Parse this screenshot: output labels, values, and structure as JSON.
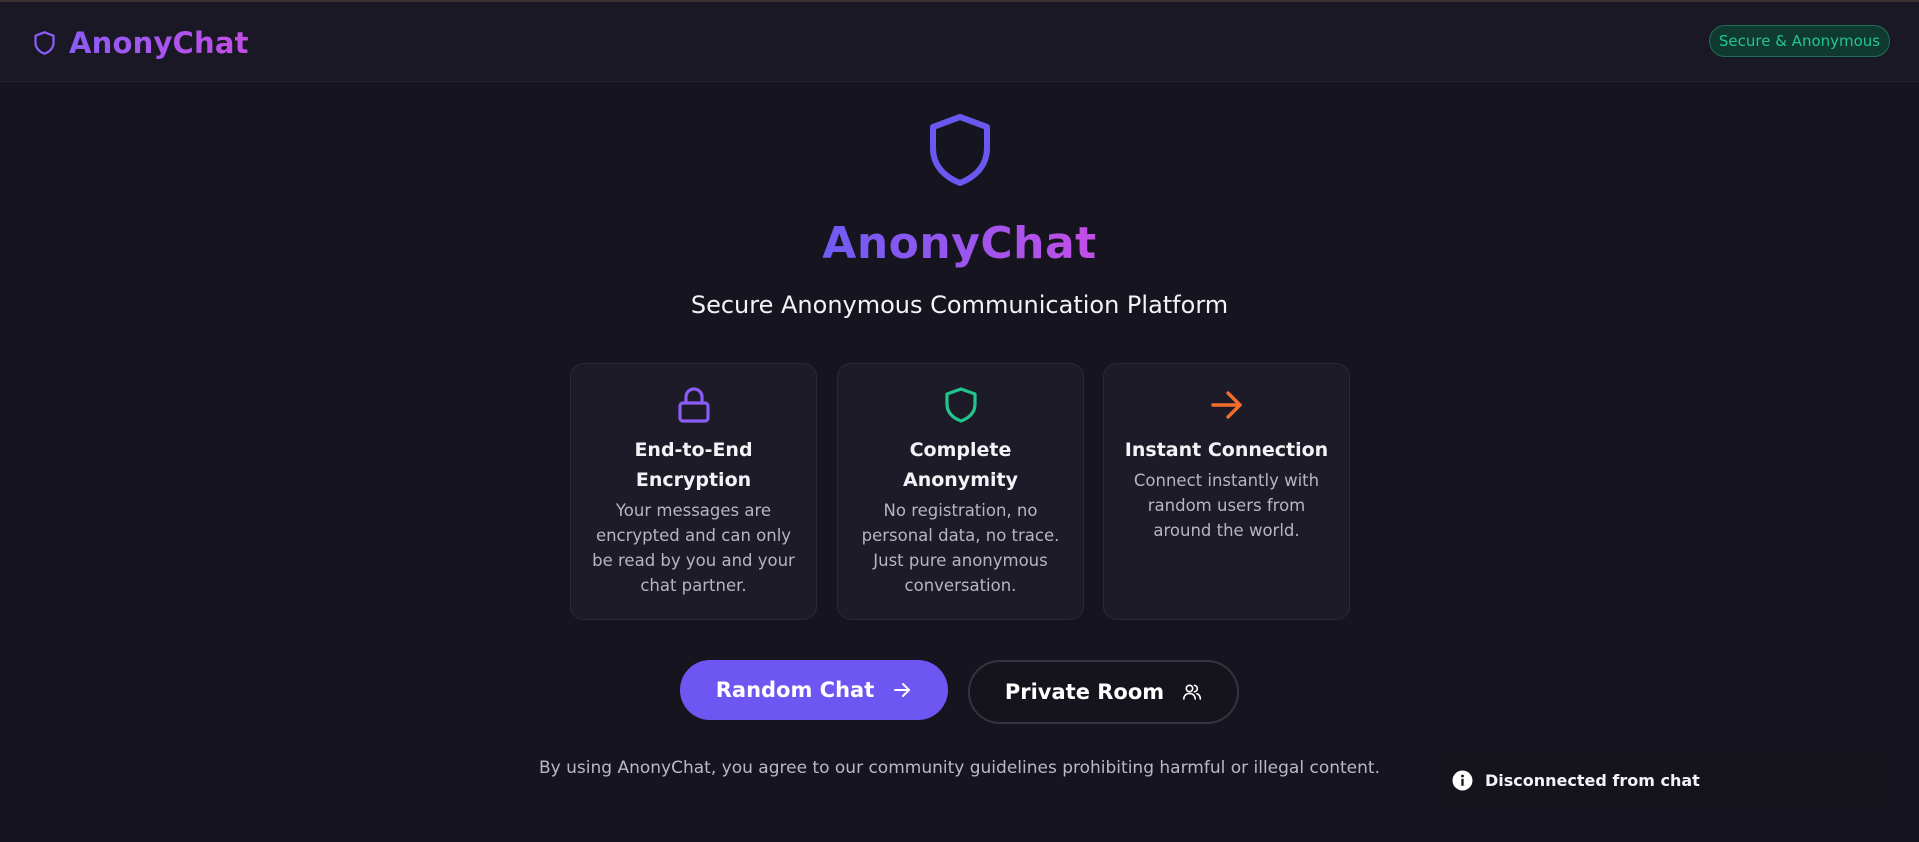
{
  "header": {
    "brand_name": "AnonyChat",
    "badge_text": "Secure & Anonymous",
    "brand_icon": "shield-icon"
  },
  "hero": {
    "title": "AnonyChat",
    "subtitle": "Secure Anonymous Communication Platform",
    "icon": "shield-icon"
  },
  "features": [
    {
      "icon": "lock-icon",
      "color": "#8b5cf6",
      "title_lines": [
        "End-to-End",
        "Encryption"
      ],
      "desc_lines": [
        "Your messages are",
        "encrypted and can only",
        "be read by you and your",
        "chat partner."
      ]
    },
    {
      "icon": "shield-icon",
      "color": "#22c58e",
      "title_lines": [
        "Complete Anonymity"
      ],
      "desc_lines": [
        "No registration, no",
        "personal data, no trace.",
        "Just pure anonymous",
        "conversation."
      ]
    },
    {
      "icon": "arrow-right-icon",
      "color": "#f36d2a",
      "title_lines": [
        "Instant Connection"
      ],
      "desc_lines": [
        "Connect instantly with",
        "random users from",
        "around the world."
      ]
    }
  ],
  "actions": {
    "random_chat": "Random Chat",
    "private_room": "Private Room"
  },
  "footer_note": "By using AnonyChat, you agree to our community guidelines prohibiting harmful or illegal content.",
  "toast": {
    "icon": "info-icon",
    "message": "Disconnected from chat"
  },
  "colors": {
    "accent": "#6d56f2",
    "brand_gradient_start": "#8b5cf6",
    "brand_gradient_end": "#c44ee6",
    "success": "#22c58e",
    "orange": "#f36d2a",
    "background": "#16151f"
  }
}
